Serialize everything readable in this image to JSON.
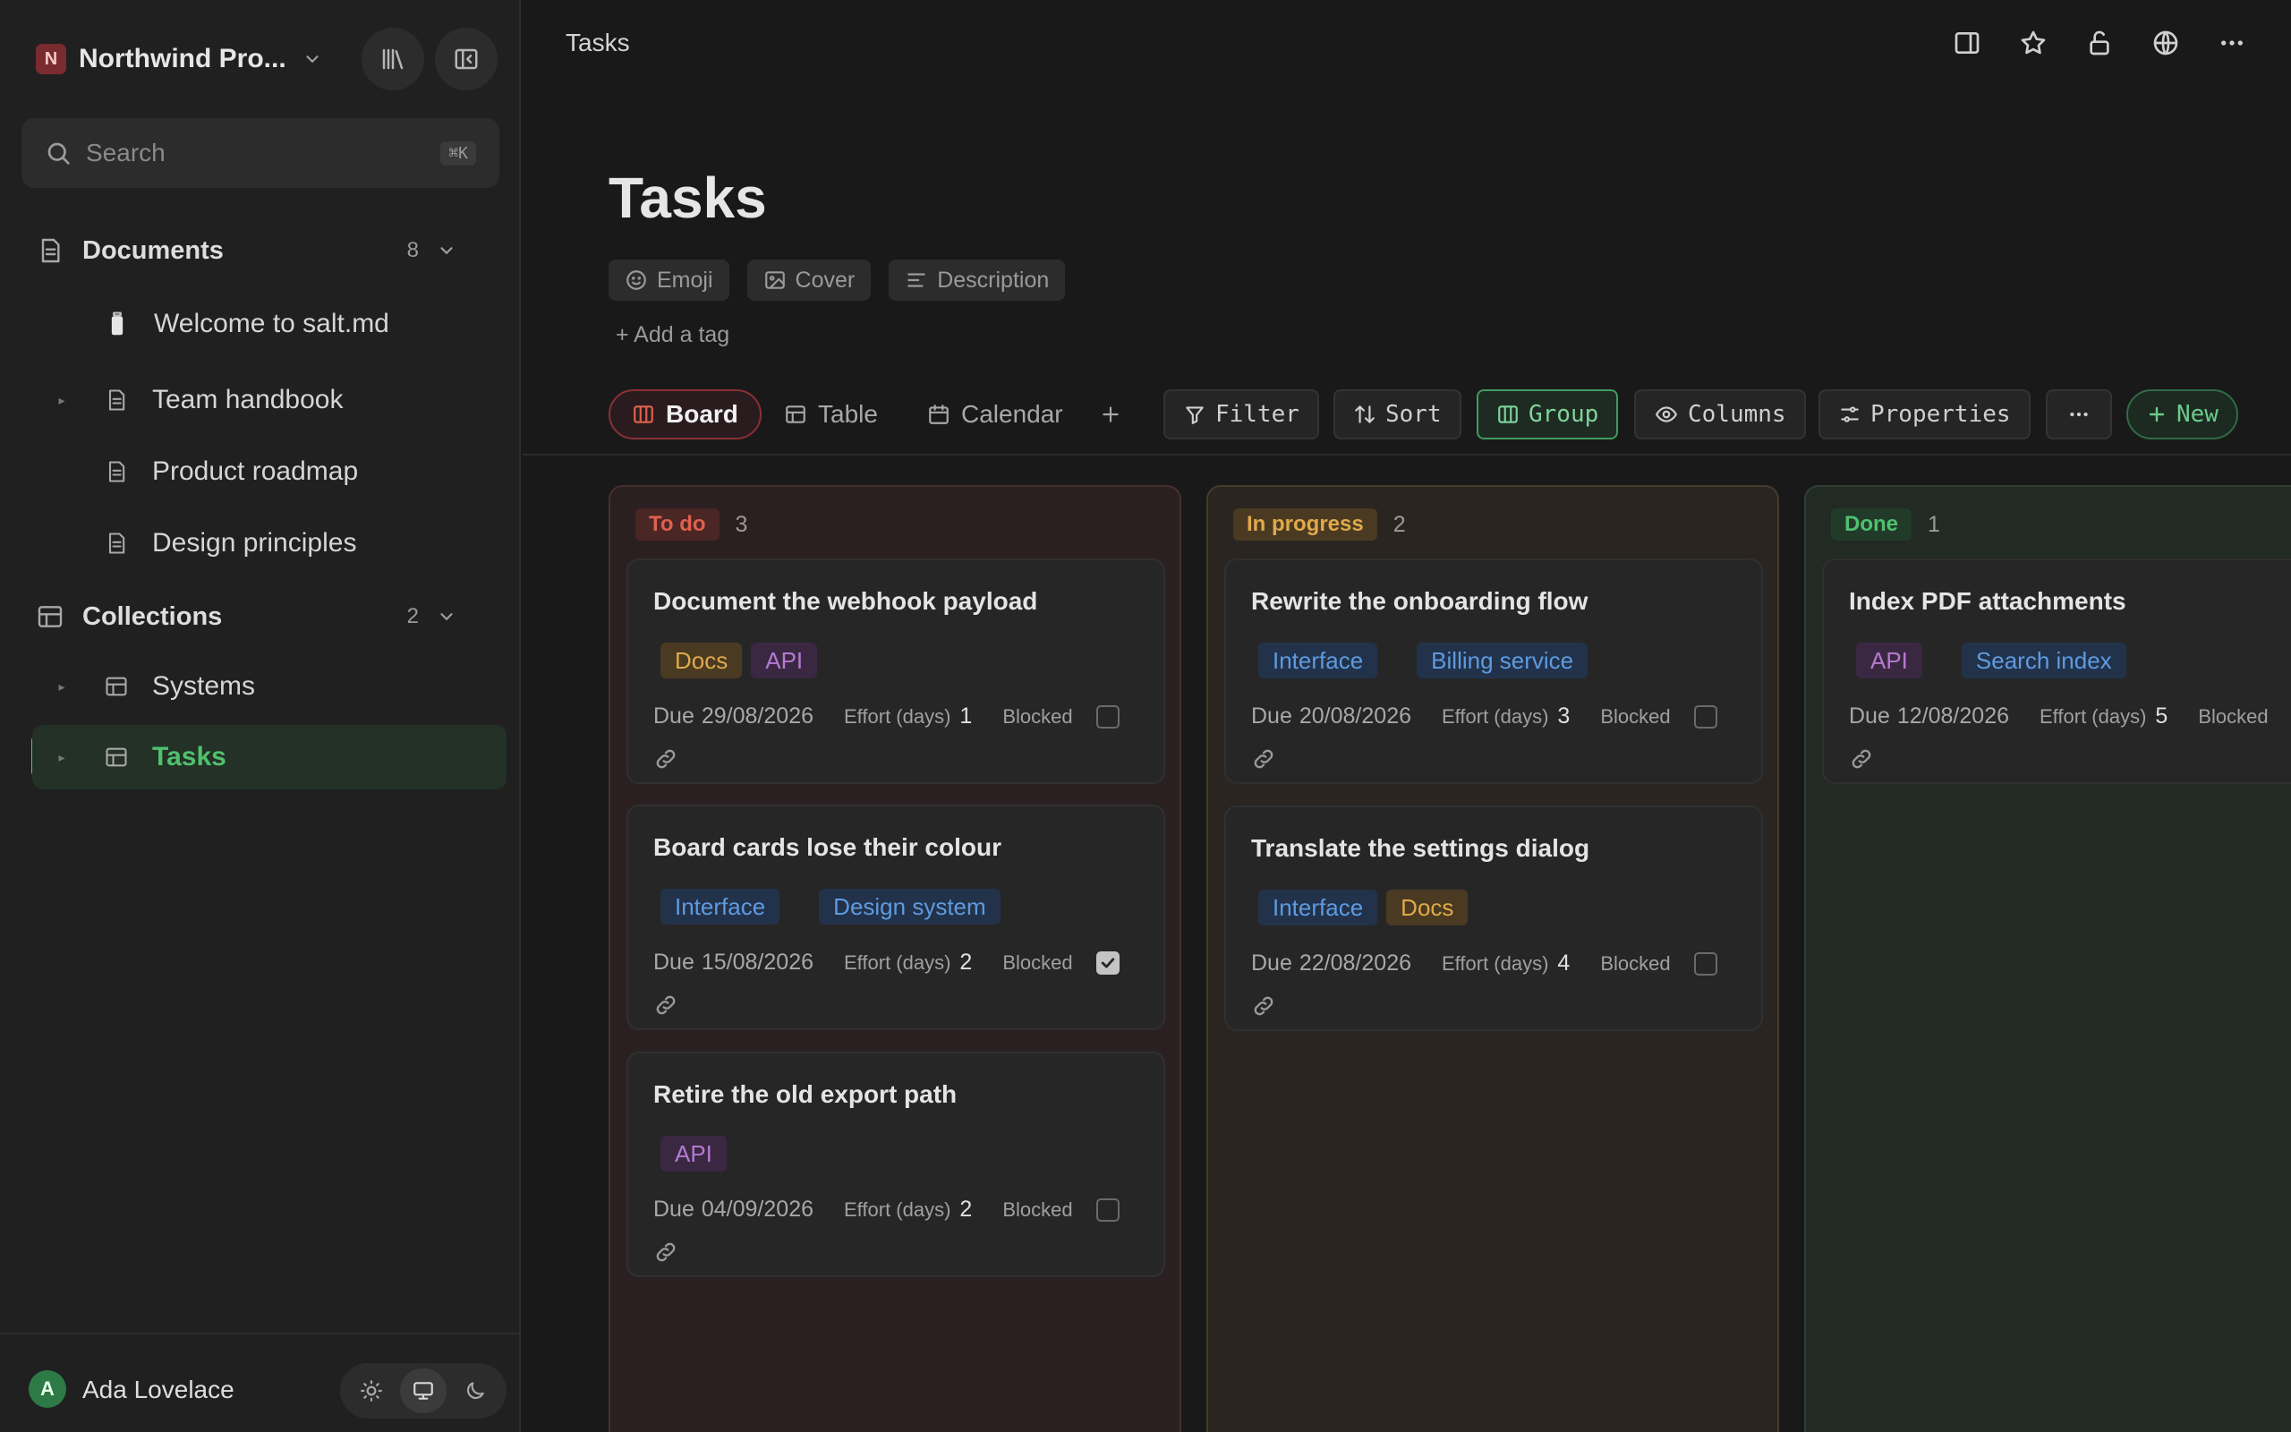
{
  "workspace": {
    "initial": "N",
    "name": "Northwind Pro..."
  },
  "search": {
    "placeholder": "Search",
    "shortcut": "⌘K"
  },
  "sections": {
    "documents": {
      "label": "Documents",
      "count": "8"
    },
    "collections": {
      "label": "Collections",
      "count": "2"
    }
  },
  "nav": {
    "documents": [
      {
        "label": "Welcome to salt.md",
        "icon": "salt-shaker-icon"
      },
      {
        "label": "Team handbook",
        "icon": "document-icon"
      },
      {
        "label": "Product roadmap",
        "icon": "document-icon"
      },
      {
        "label": "Design principles",
        "icon": "document-icon"
      }
    ],
    "collections": [
      {
        "label": "Systems",
        "icon": "table-icon"
      },
      {
        "label": "Tasks",
        "icon": "table-icon",
        "active": true
      }
    ]
  },
  "user": {
    "initial": "A",
    "name": "Ada Lovelace"
  },
  "topbar": {
    "title": "Tasks"
  },
  "page": {
    "title": "Tasks",
    "meta": {
      "emoji": "Emoji",
      "cover": "Cover",
      "description": "Description"
    },
    "add_tag": "+ Add a tag"
  },
  "views": {
    "board": "Board",
    "table": "Table",
    "calendar": "Calendar",
    "active": "Board"
  },
  "tools": {
    "filter": "Filter",
    "sort": "Sort",
    "group": "Group",
    "columns": "Columns",
    "properties": "Properties",
    "new": "New"
  },
  "colors": {
    "accent_green": "#4fc16d",
    "todo": "#e0614f",
    "in_progress": "#e0a94a",
    "done": "#4fc16d"
  },
  "labels": {
    "due": "Due",
    "effort": "Effort (days)",
    "blocked": "Blocked"
  },
  "board": {
    "columns": [
      {
        "name": "To do",
        "count": "3",
        "cards": [
          {
            "title": "Document the webhook payload",
            "tags": [
              "Docs",
              "API"
            ],
            "due": "29/08/2026",
            "effort": "1",
            "blocked": false
          },
          {
            "title": "Board cards lose their colour",
            "tags": [
              "Interface",
              "Design system"
            ],
            "due": "15/08/2026",
            "effort": "2",
            "blocked": true
          },
          {
            "title": "Retire the old export path",
            "tags": [
              "API"
            ],
            "due": "04/09/2026",
            "effort": "2",
            "blocked": false
          }
        ]
      },
      {
        "name": "In progress",
        "count": "2",
        "cards": [
          {
            "title": "Rewrite the onboarding flow",
            "tags": [
              "Interface",
              "Billing service"
            ],
            "due": "20/08/2026",
            "effort": "3",
            "blocked": false
          },
          {
            "title": "Translate the settings dialog",
            "tags": [
              "Interface",
              "Docs"
            ],
            "due": "22/08/2026",
            "effort": "4",
            "blocked": false
          }
        ]
      },
      {
        "name": "Done",
        "count": "1",
        "cards": [
          {
            "title": "Index PDF attachments",
            "tags": [
              "API",
              "Search index"
            ],
            "due": "12/08/2026",
            "effort": "5",
            "blocked": false
          }
        ]
      }
    ]
  }
}
